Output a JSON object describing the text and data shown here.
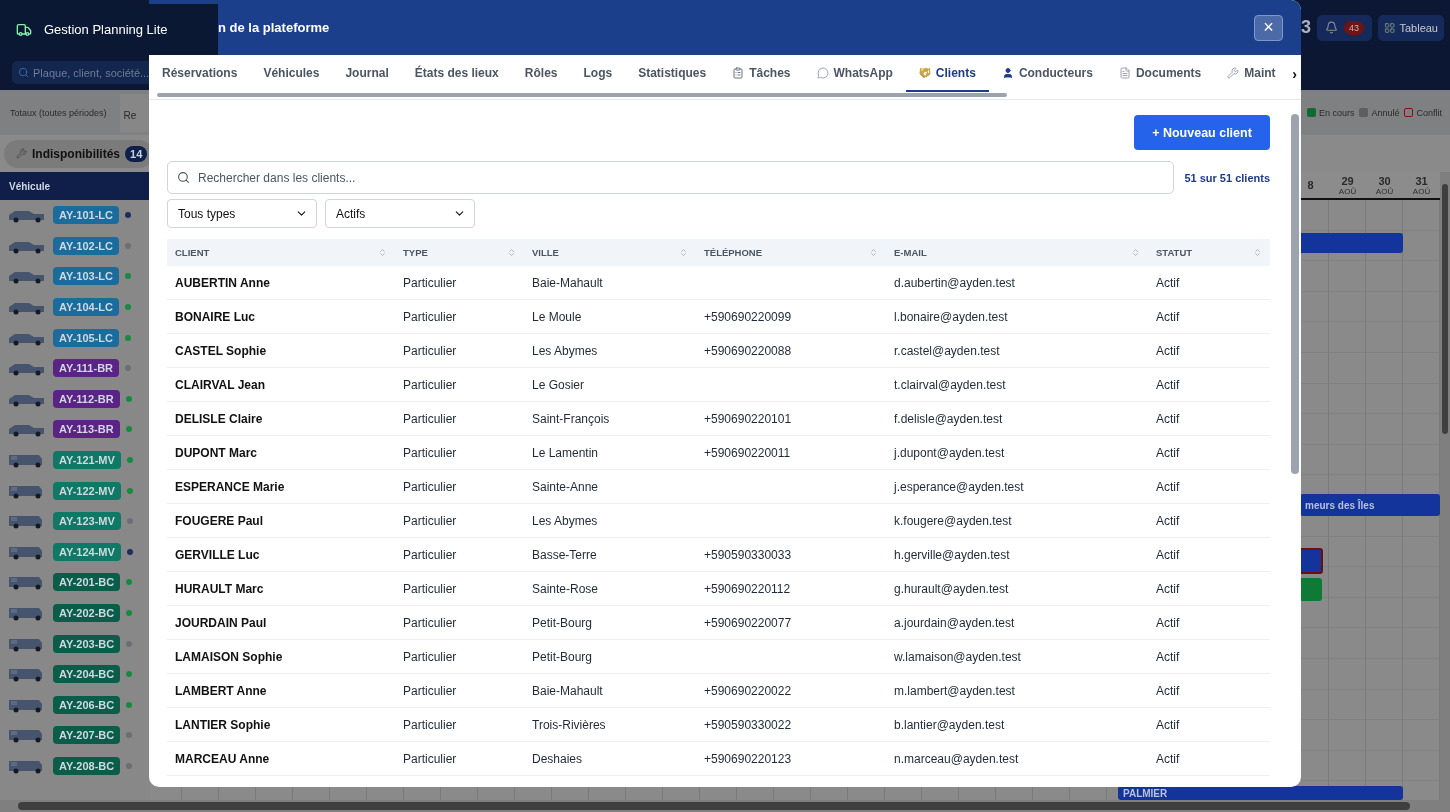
{
  "app": {
    "title": "Gestion Planning Lite",
    "header_count": "3",
    "alerts_badge": "43",
    "dashboard_button": "Tableau",
    "search": {
      "placeholder": "Plaque, client, société..."
    },
    "totals_label": "Totaux (toutes périodes)",
    "totals_card_text": "Re",
    "legend": [
      {
        "label": "En cours",
        "color": "#0e6b31",
        "kind": "fill"
      },
      {
        "label": "Annulé",
        "color": "#5e5e5e",
        "kind": "fill"
      },
      {
        "label": "Conflit",
        "color": "#7f1414",
        "kind": "outline"
      }
    ],
    "unavailability": {
      "label": "Indisponibilités",
      "count": "14"
    },
    "vehicle_column": "Véhicule",
    "vehicles": [
      {
        "plate": "AY-101-LC",
        "kind": "car",
        "color": "#1a6c9c",
        "status": {
          "color": "#1c2d5c"
        }
      },
      {
        "plate": "AY-102-LC",
        "kind": "car",
        "color": "#1a6c9c",
        "status": {
          "color": "#6b6f75"
        }
      },
      {
        "plate": "AY-103-LC",
        "kind": "car",
        "color": "#1a6c9c",
        "status": {
          "color": "#168a3e"
        }
      },
      {
        "plate": "AY-104-LC",
        "kind": "car",
        "color": "#1a6c9c",
        "status": {
          "color": "#168a3e"
        }
      },
      {
        "plate": "AY-105-LC",
        "kind": "car",
        "color": "#1a6c9c",
        "status": {
          "color": "#168a3e"
        }
      },
      {
        "plate": "AY-111-BR",
        "kind": "car",
        "color": "#5b2386",
        "status": {
          "color": "#6b6f75"
        }
      },
      {
        "plate": "AY-112-BR",
        "kind": "car",
        "color": "#5b2386",
        "status": {
          "color": "#168a3e"
        }
      },
      {
        "plate": "AY-113-BR",
        "kind": "car",
        "color": "#5b2386",
        "status": {
          "color": "#168a3e"
        }
      },
      {
        "plate": "AY-121-MV",
        "kind": "van",
        "color": "#0e7a66",
        "status": {
          "color": "#168a3e"
        }
      },
      {
        "plate": "AY-122-MV",
        "kind": "van",
        "color": "#0e7a66",
        "status": {
          "color": "#168a3e"
        }
      },
      {
        "plate": "AY-123-MV",
        "kind": "van",
        "color": "#0e7a66",
        "status": {
          "color": "#6b6f75"
        }
      },
      {
        "plate": "AY-124-MV",
        "kind": "van",
        "color": "#0e7a66",
        "status": {
          "color": "#1c2d5c"
        }
      },
      {
        "plate": "AY-201-BC",
        "kind": "van",
        "color": "#0a5e49",
        "status": {
          "color": "#168a3e"
        }
      },
      {
        "plate": "AY-202-BC",
        "kind": "van",
        "color": "#0a5e49",
        "status": {
          "color": "#168a3e"
        }
      },
      {
        "plate": "AY-203-BC",
        "kind": "van",
        "color": "#0a5e49",
        "status": {
          "color": "#6b6f75"
        }
      },
      {
        "plate": "AY-204-BC",
        "kind": "van",
        "color": "#0a5e49",
        "status": {
          "color": "#168a3e"
        }
      },
      {
        "plate": "AY-206-BC",
        "kind": "van",
        "color": "#0a5e49",
        "status": {
          "color": "#168a3e"
        }
      },
      {
        "plate": "AY-207-BC",
        "kind": "van",
        "color": "#0a5e49",
        "status": {
          "color": "#6b6f75"
        }
      },
      {
        "plate": "AY-208-BC",
        "kind": "van",
        "color": "#0a5e49",
        "status": {
          "color": "#6b6f75"
        }
      }
    ],
    "days": [
      {
        "day": "8"
      },
      {
        "day": "29",
        "month": "AOÛ"
      },
      {
        "day": "30",
        "month": "AOÛ"
      },
      {
        "day": "31",
        "month": "AOÛ"
      }
    ],
    "events": [
      {
        "color": "#13349a",
        "conflict": false
      },
      {
        "label": "meurs des Îles",
        "color": "#13349a",
        "conflict": false
      },
      {
        "color": "#13349a",
        "conflict": true
      },
      {
        "color": "#0f7a35",
        "conflict": false
      },
      {
        "label": "PALMIER",
        "color": "#13349a",
        "conflict": false
      }
    ]
  },
  "modal": {
    "title": "n de la plateforme",
    "close": "×",
    "tabs": [
      {
        "label": "Réservations",
        "selected": false
      },
      {
        "label": "Véhicules",
        "selected": false
      },
      {
        "label": "Journal",
        "selected": false
      },
      {
        "label": "États des lieux",
        "selected": false
      },
      {
        "label": "Rôles",
        "selected": false
      },
      {
        "label": "Logs",
        "selected": false
      },
      {
        "label": "Statistiques",
        "selected": false
      },
      {
        "label": "Tâches",
        "selected": false
      },
      {
        "label": "WhatsApp",
        "selected": false
      },
      {
        "label": "Clients",
        "selected": true
      },
      {
        "label": "Conducteurs",
        "selected": false
      },
      {
        "label": "Documents",
        "selected": false
      },
      {
        "label": "Maint",
        "selected": false
      }
    ],
    "tabs_scroll": "›",
    "new_button": "+ Nouveau client",
    "search": {
      "placeholder": "Rechercher dans les clients..."
    },
    "count": "51 sur 51 clients",
    "filters": [
      {
        "value": "Tous types"
      },
      {
        "value": "Actifs"
      }
    ],
    "table": {
      "columns": [
        "CLIENT",
        "TYPE",
        "VILLE",
        "TÉLÉPHONE",
        "E-MAIL",
        "STATUT"
      ],
      "rows": [
        [
          "AUBERTIN Anne",
          "Particulier",
          "Baie-Mahault",
          "",
          "d.aubertin@ayden.test",
          "Actif"
        ],
        [
          "BONAIRE Luc",
          "Particulier",
          "Le Moule",
          "+590690220099",
          "l.bonaire@ayden.test",
          "Actif"
        ],
        [
          "CASTEL Sophie",
          "Particulier",
          "Les Abymes",
          "+590690220088",
          "r.castel@ayden.test",
          "Actif"
        ],
        [
          "CLAIRVAL Jean",
          "Particulier",
          "Le Gosier",
          "",
          "t.clairval@ayden.test",
          "Actif"
        ],
        [
          "DELISLE Claire",
          "Particulier",
          "Saint-François",
          "+590690220101",
          "f.delisle@ayden.test",
          "Actif"
        ],
        [
          "DUPONT Marc",
          "Particulier",
          "Le Lamentin",
          "+590690220011",
          "j.dupont@ayden.test",
          "Actif"
        ],
        [
          "ESPERANCE Marie",
          "Particulier",
          "Sainte-Anne",
          "",
          "j.esperance@ayden.test",
          "Actif"
        ],
        [
          "FOUGERE Paul",
          "Particulier",
          "Les Abymes",
          "",
          "k.fougere@ayden.test",
          "Actif"
        ],
        [
          "GERVILLE Luc",
          "Particulier",
          "Basse-Terre",
          "+590590330033",
          "h.gerville@ayden.test",
          "Actif"
        ],
        [
          "HURAULT Marc",
          "Particulier",
          "Sainte-Rose",
          "+590690220112",
          "g.hurault@ayden.test",
          "Actif"
        ],
        [
          "JOURDAIN Paul",
          "Particulier",
          "Petit-Bourg",
          "+590690220077",
          "a.jourdain@ayden.test",
          "Actif"
        ],
        [
          "LAMAISON Sophie",
          "Particulier",
          "Petit-Bourg",
          "",
          "w.lamaison@ayden.test",
          "Actif"
        ],
        [
          "LAMBERT Anne",
          "Particulier",
          "Baie-Mahault",
          "+590690220022",
          "m.lambert@ayden.test",
          "Actif"
        ],
        [
          "LANTIER Sophie",
          "Particulier",
          "Trois-Rivières",
          "+590590330022",
          "b.lantier@ayden.test",
          "Actif"
        ],
        [
          "MARCEAU Anne",
          "Particulier",
          "Deshaies",
          "+590690220123",
          "n.marceau@ayden.test",
          "Actif"
        ]
      ]
    }
  }
}
